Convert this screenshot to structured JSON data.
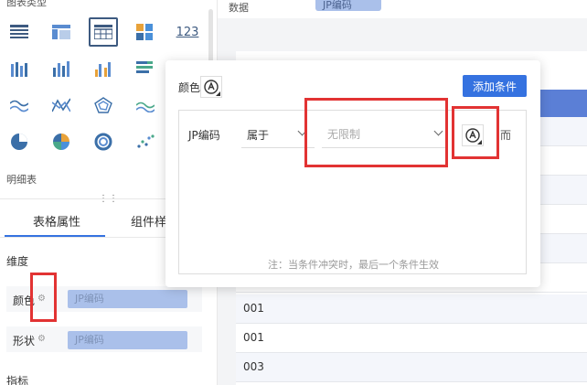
{
  "left_panel": {
    "chart_types_title": "图表类型",
    "chart_icons": [
      "table-icon",
      "cross-table-icon",
      "detail-table-icon",
      "kpi-card-icon",
      "number-icon",
      "stacked-column-icon",
      "column-chart-icon",
      "grouped-column-icon",
      "stacked-bar-icon",
      "line-chart-icon",
      "multi-line-icon",
      "radar-icon",
      "area-chart-icon",
      "pie-chart-icon",
      "rose-chart-icon",
      "donut-chart-icon",
      "scatter-icon"
    ],
    "number_icon_text": "123",
    "selected_type_label": "明细表",
    "drag_handle": "⋮⋮",
    "tabs": [
      {
        "label": "表格属性",
        "active": true
      },
      {
        "label": "组件样"
      }
    ],
    "dimension_title": "维度",
    "rows": [
      {
        "label": "颜色",
        "pill": "JP编码"
      },
      {
        "label": "形状",
        "pill": "JP编码"
      }
    ],
    "indicator_title": "指标"
  },
  "right_panel": {
    "data_label": "数据",
    "data_pill": "JP编码",
    "rows": [
      "",
      "",
      "",
      "",
      "",
      "",
      "001",
      "001",
      "003"
    ]
  },
  "popup": {
    "color_label": "颜色",
    "add_button": "添加条件",
    "condition": {
      "field": "JP编码",
      "operator": "属于",
      "value_placeholder": "无限制",
      "delete_glyph": "而"
    },
    "note": "注：当条件冲突时，最后一个条件生效"
  },
  "colors": {
    "accent": "#3572e0",
    "highlight": "#e23333",
    "pill": "#aac0ea",
    "table_header": "#5b7fd6"
  }
}
